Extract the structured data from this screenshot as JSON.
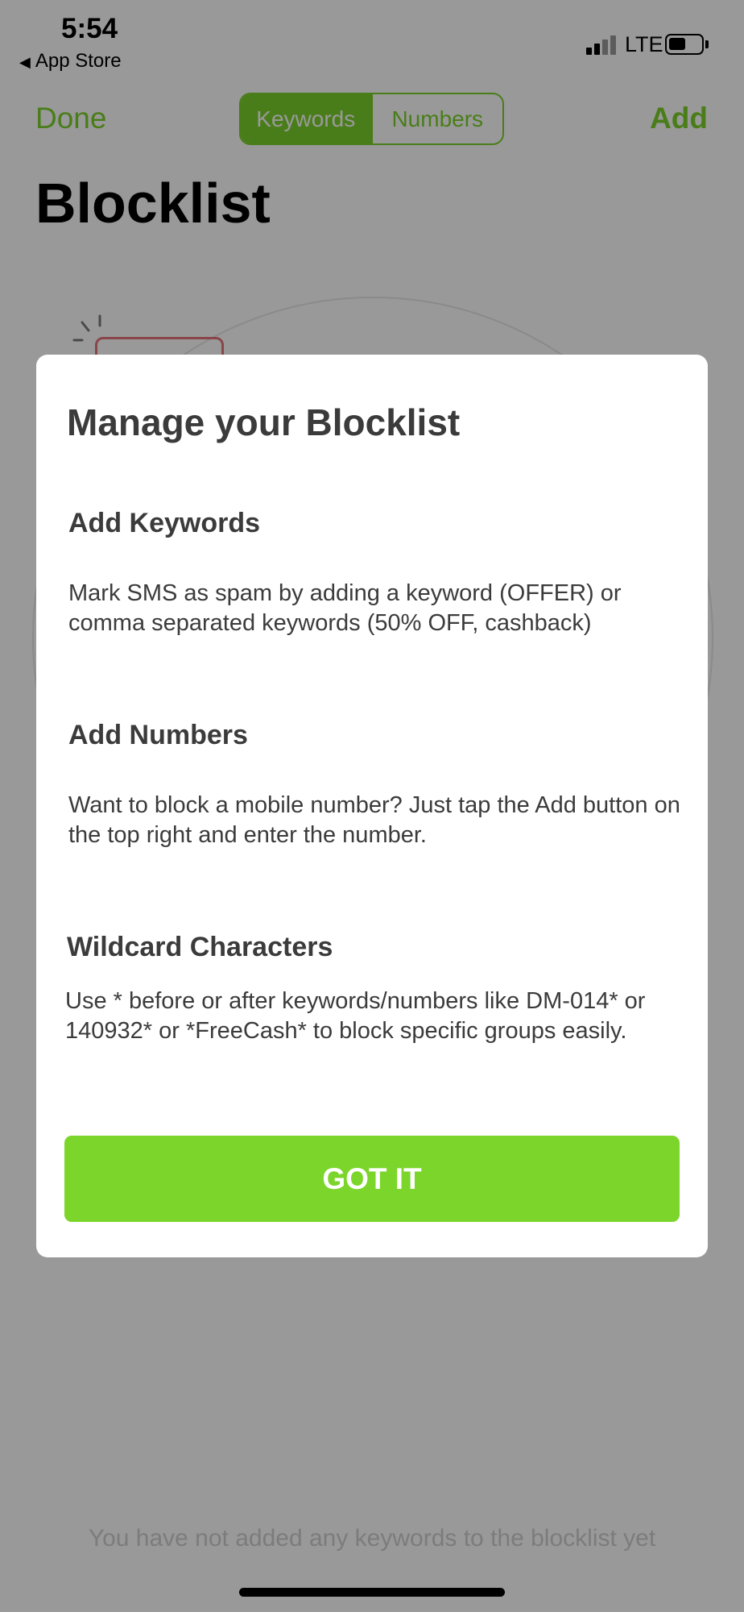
{
  "status_bar": {
    "time": "5:54",
    "back_label": "App Store",
    "carrier": "LTE",
    "battery_level": 0.55
  },
  "nav": {
    "left_label": "Done",
    "right_label": "Add",
    "segments": [
      "Keywords",
      "Numbers"
    ],
    "selected_segment": "Keywords"
  },
  "page": {
    "title": "Blocklist",
    "empty_message": "You have not added any keywords to the blocklist yet"
  },
  "modal": {
    "title": "Manage your Blocklist",
    "sections": [
      {
        "heading": "Add Keywords",
        "body": "Mark SMS as spam by adding a keyword (OFFER) or comma separated keywords (50% OFF, cashback)"
      },
      {
        "heading": "Add Numbers",
        "body": "Want to block a mobile number? Just tap the Add button on the top right and enter the number."
      },
      {
        "heading": "Wildcard Characters",
        "body": "Use * before or after keywords/numbers like DM-014* or 140932* or *FreeCash* to block specific groups easily."
      }
    ],
    "button_label": "GOT IT"
  },
  "colors": {
    "accent_green": "#7bd12a",
    "button_green": "#7bd52a",
    "overlay": "rgba(0,0,0,0.40)"
  }
}
